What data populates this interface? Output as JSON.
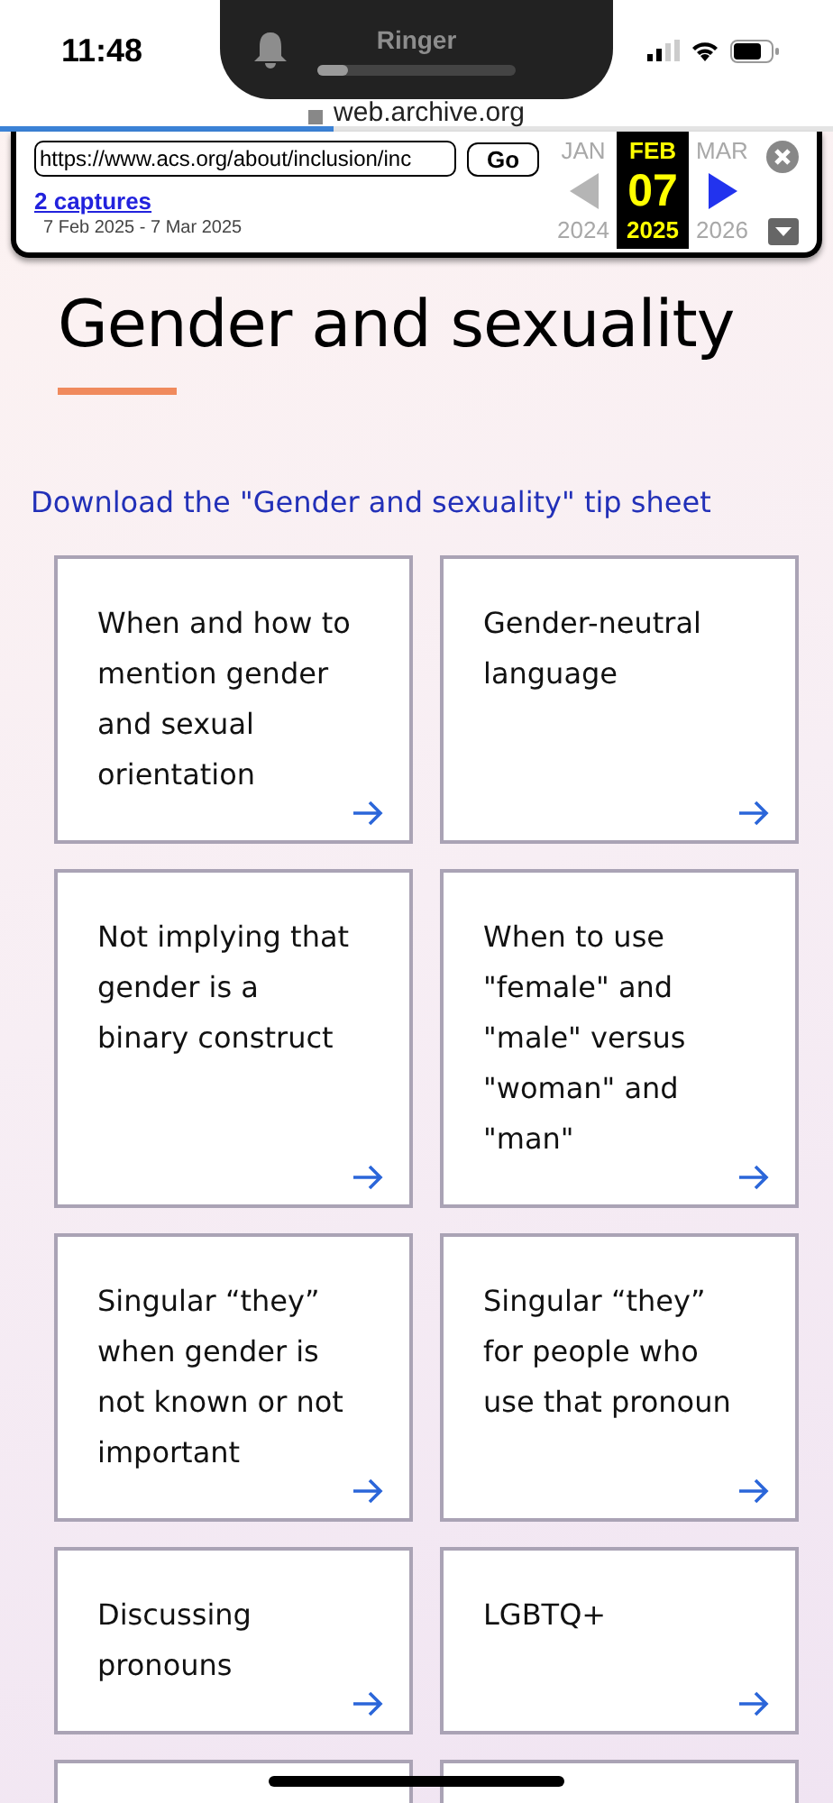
{
  "status_bar": {
    "time": "11:48"
  },
  "ringer": {
    "label": "Ringer",
    "level": 0.15
  },
  "browser": {
    "address": "web.archive.org",
    "load": {
      "level": 0.4
    }
  },
  "wayback": {
    "url": "https://www.acs.org/about/inclusion/inc",
    "go": "Go",
    "captures": "2 captures",
    "range": "7 Feb 2025 - 7 Mar 2025",
    "prev": {
      "disabled": true
    },
    "next": {
      "disabled": false
    },
    "months": [
      {
        "month": "JAN",
        "year": "2024",
        "selected": false
      },
      {
        "month": "FEB",
        "day": "07",
        "year": "2025",
        "selected": true
      },
      {
        "month": "MAR",
        "year": "2026",
        "selected": false
      }
    ]
  },
  "page": {
    "title": "Gender and sexuality",
    "link": "Download the \"Gender and sexuality\" tip sheet",
    "cards": [
      {
        "title": "When and how to mention gender and sexual orientation"
      },
      {
        "title": "Gender-neutral language"
      },
      {
        "title": "Not implying that gender is a binary construct"
      },
      {
        "title": "When to use \"female\" and \"male\" versus \"woman\" and \"man\""
      },
      {
        "title": "Singular “they” when gender is not known or not important"
      },
      {
        "title": "Singular “they” for people who use that pronoun"
      },
      {
        "title": "Discussing pronouns"
      },
      {
        "title": "LGBTQ+"
      }
    ]
  }
}
